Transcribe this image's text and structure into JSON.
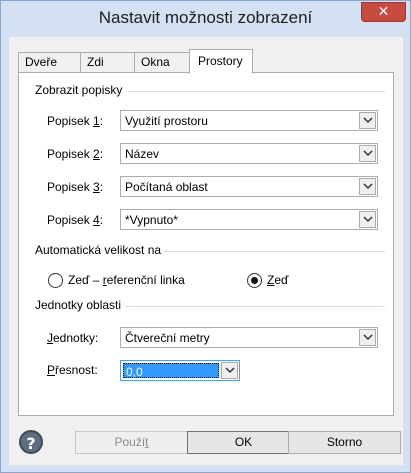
{
  "window": {
    "title": "Nastavit možnosti zobrazení",
    "close_glyph": "✕"
  },
  "tabs": [
    {
      "label": "Dveře"
    },
    {
      "label": "Zdi"
    },
    {
      "label": "Okna"
    },
    {
      "label": "Prostory"
    }
  ],
  "labels_section": {
    "header": "Zobrazit popisky",
    "rows": [
      {
        "label_prefix": "Popisek ",
        "label_key": "1",
        "label_suffix": ":",
        "value": "Využití prostoru"
      },
      {
        "label_prefix": "Popisek ",
        "label_key": "2",
        "label_suffix": ":",
        "value": "Název"
      },
      {
        "label_prefix": "Popisek ",
        "label_key": "3",
        "label_suffix": ":",
        "value": "Počítaná oblast"
      },
      {
        "label_prefix": "Popisek ",
        "label_key": "4",
        "label_suffix": ":",
        "value": "*Vypnuto*"
      }
    ]
  },
  "autosize_section": {
    "header": "Automatická velikost na",
    "option1": {
      "pre": "Zeď – ",
      "key": "r",
      "post": "eferenční linka",
      "selected": false
    },
    "option2": {
      "pre": "",
      "key": "Z",
      "post": "eď",
      "selected": true
    }
  },
  "units_section": {
    "header": "Jednotky oblasti",
    "units_label": {
      "key": "J",
      "post": "ednotky:"
    },
    "units_value": "Čtvereční metry",
    "precision_label": {
      "key": "P",
      "post": "řesnost:"
    },
    "precision_value": "0,0"
  },
  "footer": {
    "help_glyph": "?",
    "apply": {
      "pre": "Použí",
      "key": "t"
    },
    "ok": "OK",
    "cancel": "Storno"
  },
  "colors": {
    "title_bar": "#d3e1f3",
    "close_button": "#c74b3f",
    "selection": "#3399ff"
  }
}
